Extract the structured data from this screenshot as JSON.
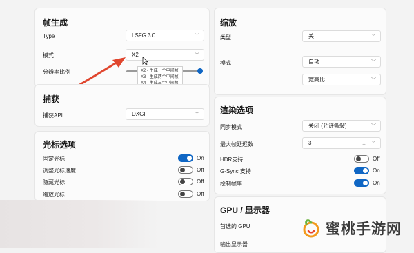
{
  "frame_gen": {
    "title": "帧生成",
    "type_label": "Type",
    "type_value": "LSFG 3.0",
    "mode_label": "模式",
    "mode_value": "X2",
    "ratio_label": "分辨率比例",
    "ratio_fraction": 1.0,
    "tooltip_lines": [
      "X2 - 生成一个中间帧",
      "X3 - 生成两个中间帧",
      "X4 - 生成三个中间帧"
    ]
  },
  "capture": {
    "title": "捕获",
    "api_label": "捕获API",
    "api_value": "DXGI"
  },
  "cursor": {
    "title": "光标选项",
    "items": [
      {
        "label": "固定光标",
        "state": "On",
        "on": true
      },
      {
        "label": "调整光标速度",
        "state": "Off",
        "on": false
      },
      {
        "label": "隐藏光标",
        "state": "Off",
        "on": false
      },
      {
        "label": "缩放光标",
        "state": "Off",
        "on": false
      }
    ]
  },
  "scaling": {
    "title": "缩放",
    "type_label": "类型",
    "type_value": "关",
    "mode_label": "模式",
    "mode_value": "自动",
    "mode_sub_value": "宽高比"
  },
  "render": {
    "title": "渲染选项",
    "sync_label": "同步模式",
    "sync_value": "关闭 (允许撕裂)",
    "max_frames_label": "最大帧延迟数",
    "max_frames_value": "3",
    "hdr_label": "HDR支持",
    "hdr_state": "Off",
    "gsync_label": "G-Sync 支持",
    "gsync_state": "On",
    "framerate_label": "绘制帧率",
    "framerate_state": "On"
  },
  "gpu": {
    "title": "GPU / 显示器",
    "preferred_label": "首选的 GPU",
    "output_label": "输出显示器"
  },
  "watermark": {
    "text": "蜜桃手游网"
  },
  "colors": {
    "accent": "#0f66c4",
    "arrow": "#e0462e"
  }
}
